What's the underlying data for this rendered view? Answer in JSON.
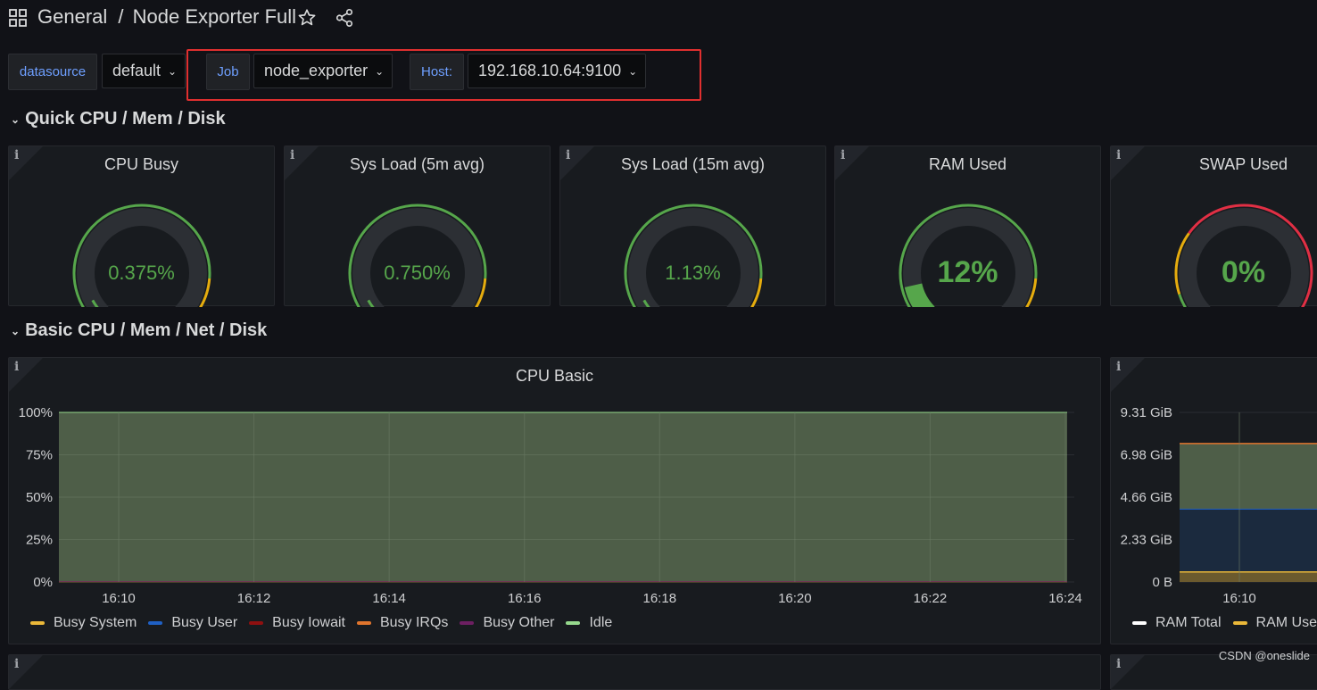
{
  "header": {
    "breadcrumb": "General",
    "separator": "/",
    "dashboard_title": "Node Exporter Full"
  },
  "variables": {
    "datasource": {
      "label": "datasource",
      "value": "default"
    },
    "job": {
      "label": "Job",
      "value": "node_exporter"
    },
    "host": {
      "label": "Host:",
      "value": "192.168.10.64:9100"
    }
  },
  "rows": {
    "quick": "Quick CPU / Mem / Disk",
    "basic": "Basic CPU / Mem / Net / Disk"
  },
  "gauges": [
    {
      "title": "CPU Busy",
      "value": "0.375%",
      "fraction": 0.00375
    },
    {
      "title": "Sys Load (5m avg)",
      "value": "0.750%",
      "fraction": 0.0075
    },
    {
      "title": "Sys Load (15m avg)",
      "value": "1.13%",
      "fraction": 0.0113
    },
    {
      "title": "RAM Used",
      "value": "12%",
      "fraction": 0.12
    },
    {
      "title": "SWAP Used",
      "value": "0%",
      "fraction": 0
    }
  ],
  "colors": {
    "green": "#56a64b",
    "orange": "#e5ac0e",
    "red": "#e02f44",
    "idle_fill": "#4e5e48",
    "idle_line": "#96d98d"
  },
  "cpu_panel": {
    "title": "CPU Basic",
    "legend": [
      {
        "name": "Busy System",
        "color": "#eab839"
      },
      {
        "name": "Busy User",
        "color": "#1f60c4"
      },
      {
        "name": "Busy Iowait",
        "color": "#8f1010"
      },
      {
        "name": "Busy IRQs",
        "color": "#e0752d"
      },
      {
        "name": "Busy Other",
        "color": "#6d1f62"
      },
      {
        "name": "Idle",
        "color": "#96d98d"
      }
    ]
  },
  "mem_panel": {
    "legend": [
      {
        "name": "RAM Total",
        "color": "#ffffff"
      },
      {
        "name": "RAM Used",
        "color": "#eab839"
      }
    ]
  },
  "chart_data": [
    {
      "type": "area",
      "title": "CPU Basic",
      "x": [
        "16:10",
        "16:12",
        "16:14",
        "16:16",
        "16:18",
        "16:20",
        "16:22",
        "16:24"
      ],
      "y_ticks": [
        "0%",
        "25%",
        "50%",
        "75%",
        "100%"
      ],
      "ylim": [
        0,
        100
      ],
      "stacked": true,
      "grid": true,
      "legend_position": "bottom-left",
      "series": [
        {
          "name": "Busy System",
          "values": [
            0.2,
            0.2,
            0.2,
            0.2,
            0.2,
            0.2,
            0.2,
            0.2
          ]
        },
        {
          "name": "Busy User",
          "values": [
            0.2,
            0.2,
            0.2,
            0.2,
            0.2,
            0.2,
            0.2,
            0.2
          ]
        },
        {
          "name": "Busy Iowait",
          "values": [
            0,
            0,
            0,
            0,
            0,
            0,
            0,
            0
          ]
        },
        {
          "name": "Busy IRQs",
          "values": [
            0,
            0,
            0,
            0,
            0,
            0,
            0,
            0
          ]
        },
        {
          "name": "Busy Other",
          "values": [
            0,
            0,
            0,
            0,
            0,
            0,
            0,
            0
          ]
        },
        {
          "name": "Idle",
          "values": [
            99.6,
            99.6,
            99.6,
            99.6,
            99.6,
            99.6,
            99.6,
            99.6
          ]
        }
      ]
    },
    {
      "type": "area",
      "title": "",
      "x": [
        "16:10"
      ],
      "y_ticks": [
        "0 B",
        "2.33 GiB",
        "4.66 GiB",
        "6.98 GiB",
        "9.31 GiB"
      ],
      "ylim": [
        0,
        9.31
      ],
      "grid": true,
      "legend_position": "bottom-left",
      "series": [
        {
          "name": "RAM Total",
          "values": [
            7.6
          ]
        },
        {
          "name": "RAM Used",
          "values": [
            0.55
          ]
        }
      ]
    }
  ],
  "watermark": "CSDN @oneslide"
}
